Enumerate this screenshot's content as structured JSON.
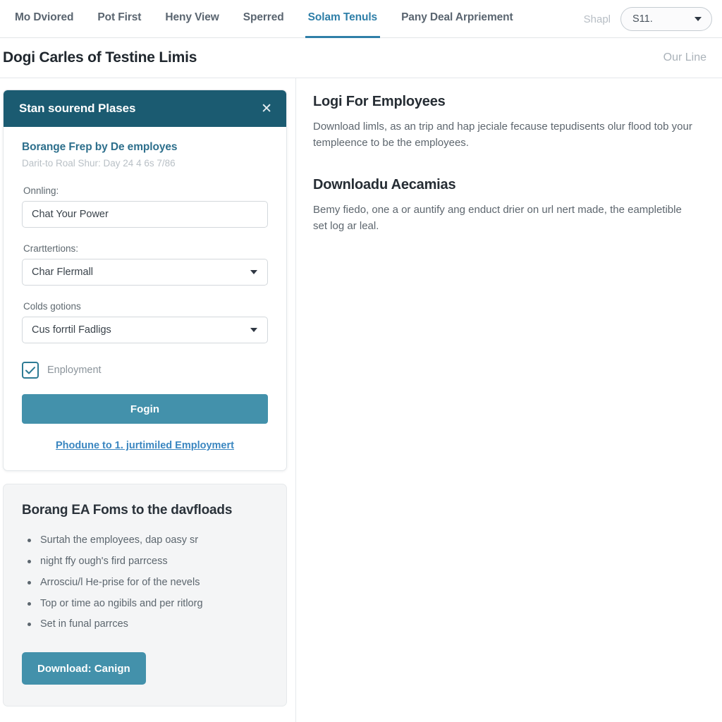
{
  "topnav": {
    "items": [
      {
        "label": "Mo Dviored",
        "active": false
      },
      {
        "label": "Pot First",
        "active": false
      },
      {
        "label": "Heny View",
        "active": false
      },
      {
        "label": "Sperred",
        "active": false
      },
      {
        "label": "Solam Tenuls",
        "active": true
      },
      {
        "label": "Pany Deal Arpriement",
        "active": false
      }
    ],
    "muted_label": "Shapl",
    "select_value": "S11.",
    "accent_color": "#2f7fa8"
  },
  "titlebar": {
    "title": "Dogi Carles of Testine Limis",
    "right_link": "Our Line"
  },
  "login_card": {
    "header_title": "Stan sourend Plases",
    "close_icon": "close-icon",
    "header_color": "#1b5b71",
    "form_heading": "Borange Frep by De employes",
    "form_sub": "Darit-to Roal Shur: Day 24 4 6s 7/86",
    "fields": [
      {
        "label": "Onnling:",
        "type": "text",
        "value": "Chat Your Power",
        "placeholder": "Chat Your Power"
      },
      {
        "label": "Crarttertions:",
        "type": "select",
        "value": "Char Flermall"
      },
      {
        "label": "Colds gotions",
        "type": "select",
        "value": "Cus forrtil Fadligs"
      }
    ],
    "checkbox": {
      "label": "Enployment",
      "checked": true,
      "color": "#2d7b94"
    },
    "submit_label": "Fogin",
    "link_label": "Phodune to 1. jurtimiled Employmert",
    "button_color": "#4391ab"
  },
  "info_card": {
    "title": "Borang EA Foms to the davfloads",
    "bullets": [
      "Surtah the employees, dap oasy sr",
      "night ffy ough's fird parrcess",
      "Arrosciu/l He-prise for of the nevels",
      "Top or time ao ngibils and per ritlorg",
      "Set in funal parrces"
    ],
    "button_label": "Download: Canign"
  },
  "right_panel": {
    "sections": [
      {
        "title": "Logi For Employees",
        "body": "Download limls, as an trip and hap jeciale fecause tepudisents olur flood tob your templeence to be the employees."
      },
      {
        "title": "Downloadu Aecamias",
        "body": "Bemy fiedo, one a or auntify ang enduct drier on url nert made, the eampletible set log ar leal."
      }
    ]
  }
}
